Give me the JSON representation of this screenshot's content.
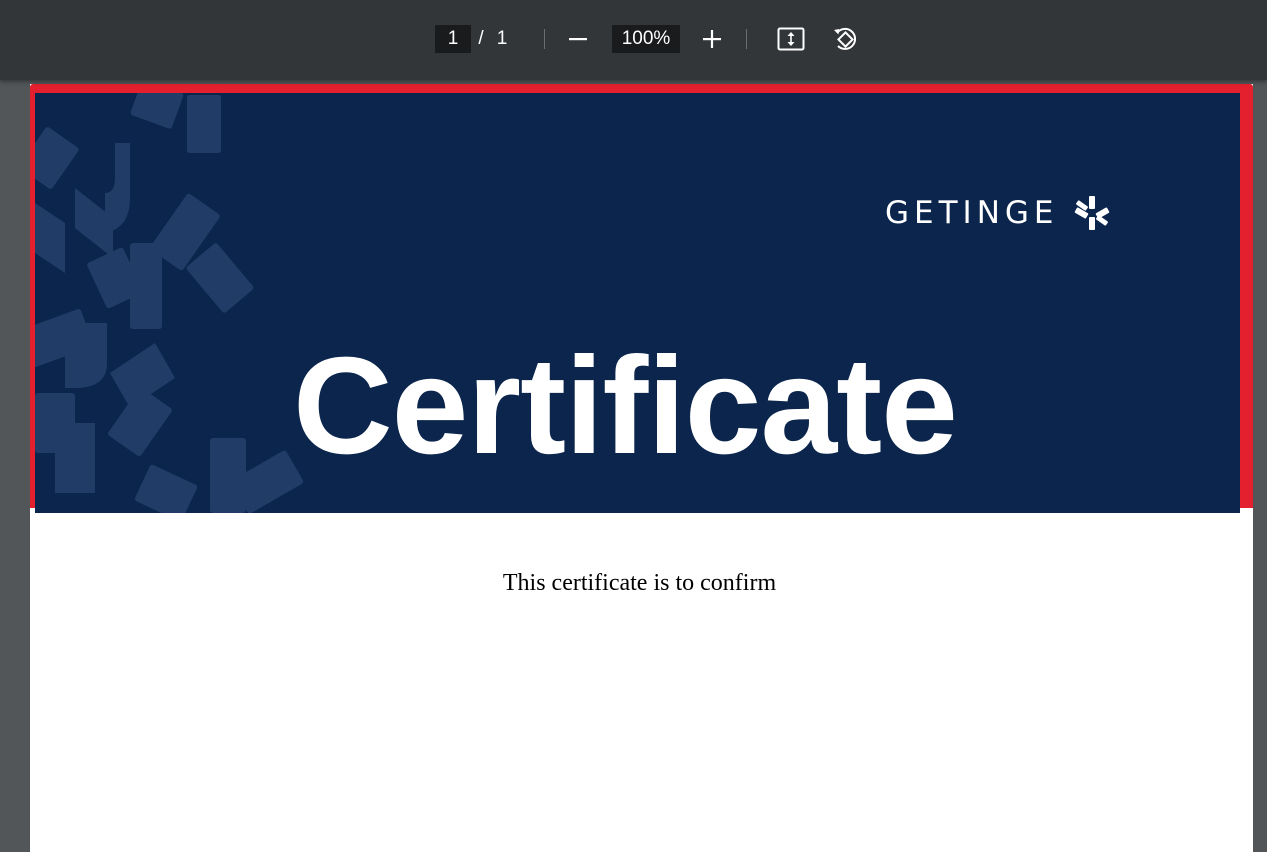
{
  "toolbar": {
    "current_page": "1",
    "page_separator": "/",
    "total_pages": "1",
    "zoom_level": "100%",
    "icons": {
      "zoom_out": "minus-icon",
      "zoom_in": "plus-icon",
      "fit_page": "fit-to-page-icon",
      "rotate": "rotate-icon"
    }
  },
  "document": {
    "banner": {
      "brand_name": "GETINGE",
      "title": "Certificate",
      "background_color": "#0b254d",
      "frame_color": "#e5202e"
    },
    "body_text": "This certificate is to confirm"
  }
}
